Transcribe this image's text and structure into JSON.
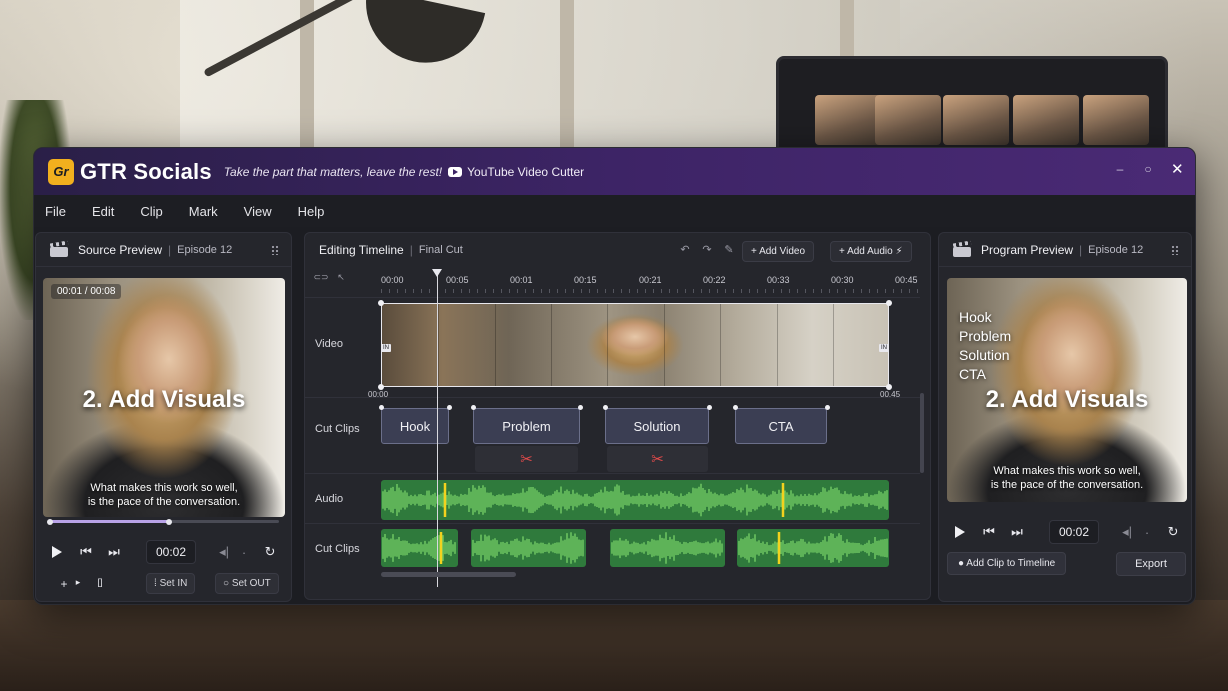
{
  "app": {
    "name": "GTR Socials",
    "logo_text": "Gr",
    "tagline": "Take the part that matters, leave the rest!",
    "product": "YouTube Video Cutter",
    "window_controls": [
      "–",
      "○",
      "✕"
    ]
  },
  "menu": [
    "File",
    "Edit",
    "Clip",
    "Mark",
    "View",
    "Help"
  ],
  "source_preview": {
    "title": "Source Preview",
    "episode": "Episode 12",
    "timecode": "00:01 / 00:08",
    "overlay_title": "2. Add Visuals",
    "caption_line1": "What makes this work so well,",
    "caption_line2": "is the pace of the conversation.",
    "scrub_progress": 0.52,
    "current_time": "00:02",
    "set_in_label": "Set IN",
    "set_out_label": "Set OUT",
    "plus_label": "+",
    "bracket_label": "[]"
  },
  "timeline": {
    "title": "Editing Timeline",
    "subtitle": "Final Cut",
    "add_video_label": "Add Video",
    "add_audio_label": "Add Audio",
    "ticks": [
      "00:00",
      "00:05",
      "00:01",
      "00:15",
      "00:21",
      "00:22",
      "00:33",
      "00:30",
      "00:45"
    ],
    "rows": [
      "Video",
      "Cut Clips",
      "Audio",
      "Cut Clips"
    ],
    "strip_start": "00:00",
    "strip_end": "00.45",
    "in_tag": "IN",
    "out_tag": "IN",
    "clips": [
      "Hook",
      "Problem",
      "Solution",
      "CTA"
    ],
    "wave_color": "#2f7a3c",
    "wave_highlight": "#7ed96b",
    "marker_color": "#f2d21e"
  },
  "program_preview": {
    "title": "Program Preview",
    "episode": "Episode 12",
    "overlay_list": [
      "Hook",
      "Problem",
      "Solution",
      "CTA"
    ],
    "overlay_title": "2. Add Visuals",
    "caption_line1": "What makes this work so well,",
    "caption_line2": "is the pace of the conversation.",
    "current_time": "00:02",
    "add_clip_label": "Add Clip to Timeline",
    "export_label": "Export"
  },
  "colors": {
    "titlebar_start": "#2a1f47",
    "titlebar_end": "#4a2a75",
    "logo": "#f2b01e",
    "scissor": "#e24a4a"
  }
}
